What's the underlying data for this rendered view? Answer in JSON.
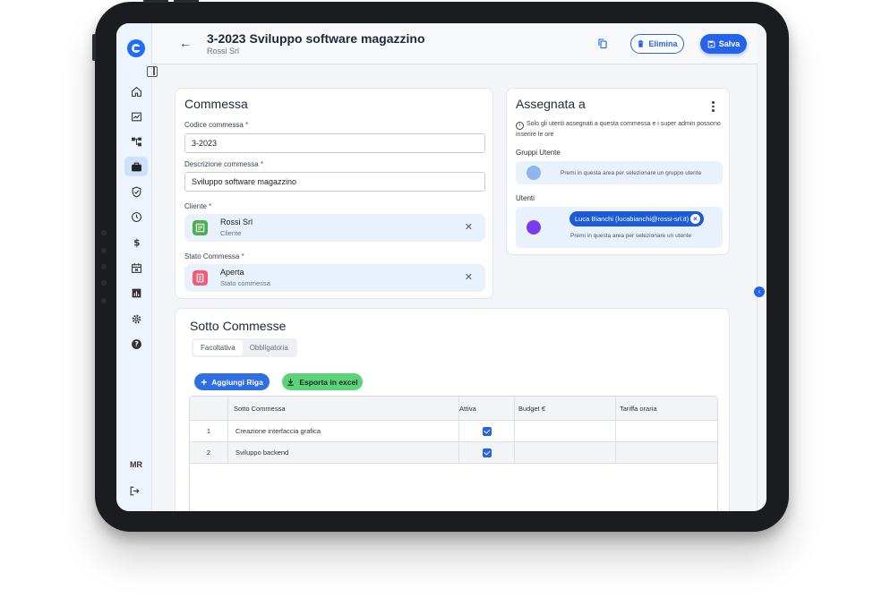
{
  "header": {
    "title": "3-2023 Sviluppo software magazzino",
    "subtitle": "Rossi Srl",
    "delete_label": "Elimina",
    "save_label": "Salva"
  },
  "sidebar": {
    "items": [
      {
        "name": "home",
        "icon": "home-icon"
      },
      {
        "name": "dashboard",
        "icon": "chart-icon"
      },
      {
        "name": "hierarchy",
        "icon": "hierarchy-icon"
      },
      {
        "name": "commesse",
        "icon": "briefcase-icon",
        "active": true
      },
      {
        "name": "tasks",
        "icon": "shield-check-icon"
      },
      {
        "name": "time",
        "icon": "clock-icon"
      },
      {
        "name": "costs",
        "icon": "dollar-icon"
      },
      {
        "name": "calendar",
        "icon": "calendar-icon"
      },
      {
        "name": "reports",
        "icon": "report-icon"
      },
      {
        "name": "settings",
        "icon": "gear-icon"
      },
      {
        "name": "help",
        "icon": "help-icon"
      }
    ],
    "user_initials": "MR"
  },
  "commessa": {
    "title": "Commessa",
    "codice_label": "Codice commessa",
    "codice_value": "3-2023",
    "descrizione_label": "Descrizione commessa",
    "descrizione_value": "Sviluppo software magazzino",
    "cliente_label": "Cliente",
    "cliente_name": "Rossi Srl",
    "cliente_sub": "Cliente",
    "stato_label": "Stato Commessa",
    "stato_name": "Aperta",
    "stato_sub": "Stato commessa",
    "required_mark": "*"
  },
  "assegnata": {
    "title": "Assegnata a",
    "info": "Solo gli utenti assegnati a questa commessa e i super admin possono inserire le ore",
    "gruppi_label": "Gruppi Utente",
    "gruppi_hint": "Premi in questa area per selezionare un gruppo utente",
    "utenti_label": "Utenti",
    "utente_chip": "Luca Bianchi (lucabianchi@rossi-srl.it)",
    "utenti_hint": "Premi in questa area per selezionare un utente"
  },
  "sotto": {
    "title": "Sotto Commesse",
    "tabs": [
      "Facoltativa",
      "Obbligatoria"
    ],
    "add_label": "Aggiungi Riga",
    "export_label": "Esporta in excel",
    "columns": [
      "",
      "Sotto Commessa",
      "Attiva",
      "Budget €",
      "Tariffa oraria"
    ],
    "rows": [
      {
        "n": "1",
        "name": "Creazione interfaccia grafica",
        "active": true
      },
      {
        "n": "2",
        "name": "Sviluppo backend",
        "active": true
      }
    ]
  },
  "colors": {
    "accent": "#2563eb",
    "excel": "#5cd37a",
    "sidebar_bg": "#eef4fd"
  }
}
